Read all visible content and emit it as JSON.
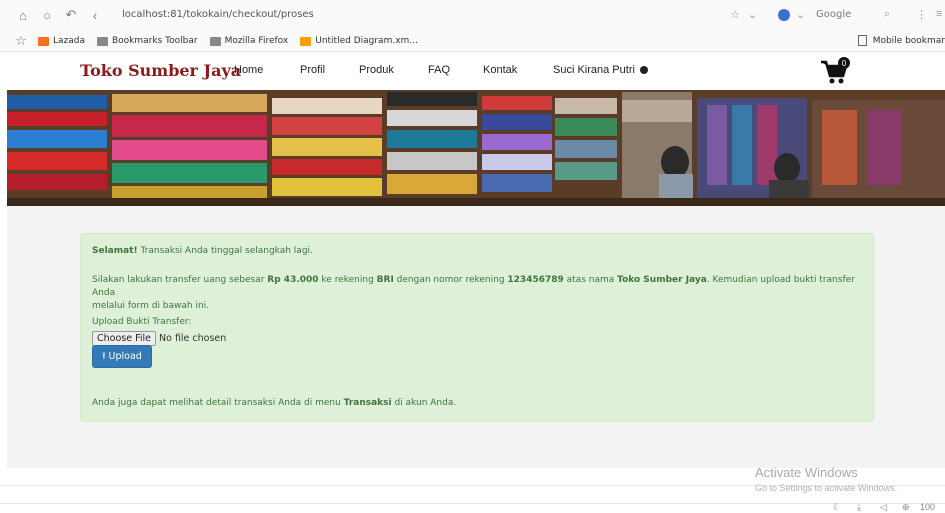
{
  "browser": {
    "url": "localhost:81/tokokain/checkout/proses",
    "search_engine": "Google",
    "bookmarks": [
      {
        "label": "Lazada",
        "color": "#f36f21"
      },
      {
        "label": "Bookmarks Toolbar",
        "color": "#888888"
      },
      {
        "label": "Mozilla Firefox",
        "color": "#888888"
      },
      {
        "label": "Untitled Diagram.xm...",
        "color": "#f4a000"
      }
    ],
    "mobile_bookmarks": "Mobile bookmar",
    "zoom": "100"
  },
  "site": {
    "brand": "Toko Sumber Jaya",
    "brand_color": "#8b1a1a",
    "menu": [
      "Home",
      "Profil",
      "Produk",
      "FAQ",
      "Kontak"
    ],
    "user": "Suci Kirana Putri",
    "cart_count": "0"
  },
  "alert": {
    "title": "Selamat!",
    "title_rest": " Transaksi Anda tinggal selangkah lagi.",
    "p2_a": "Silakan lakukan transfer uang sebesar ",
    "amount": "Rp 43.000",
    "p2_b": " ke rekening ",
    "bank": "BRI",
    "p2_c": " dengan nomor rekening ",
    "account": "123456789",
    "p2_d": " atas nama ",
    "owner": "Toko Sumber Jaya",
    "p2_e": ". Kemudian upload bukti transfer Anda",
    "p2_line2": "melalui form di bawah ini.",
    "upload_label": "Upload Bukti Transfer:",
    "choose_file": "Choose File",
    "no_file": "No file chosen",
    "upload_button": "Upload",
    "footer_a": "Anda juga dapat melihat detail transaksi Anda di menu ",
    "footer_menu": "Transaksi",
    "footer_b": " di akun Anda."
  },
  "windows": {
    "activate_title": "Activate Windows",
    "activate_sub": "Go to Settings to activate Windows."
  },
  "colors": {
    "alert_bg": "#dff0d8",
    "alert_text": "#3c763d",
    "primary_button": "#337ab7"
  }
}
